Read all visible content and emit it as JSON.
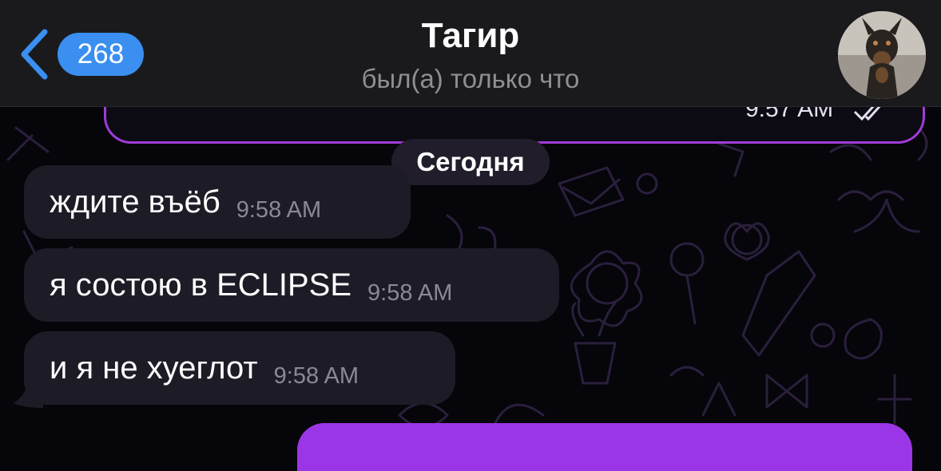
{
  "header": {
    "unread_count": "268",
    "contact_name": "Тагир",
    "contact_status": "был(а) только что"
  },
  "previous_message": {
    "time": "9:57 AM"
  },
  "date_separator": "Сегодня",
  "messages": [
    {
      "text": "ждите въёб",
      "time": "9:58 AM"
    },
    {
      "text": "я состою в ECLIPSE",
      "time": "9:58 AM"
    },
    {
      "text": "и я не хуеглот",
      "time": "9:58 AM"
    }
  ],
  "colors": {
    "accent_blue": "#3a8ff0",
    "outgoing_purple": "#9b36e6",
    "incoming_bubble": "#1d1c26"
  },
  "icons": [
    "back-chevron-icon",
    "double-check-icon"
  ]
}
